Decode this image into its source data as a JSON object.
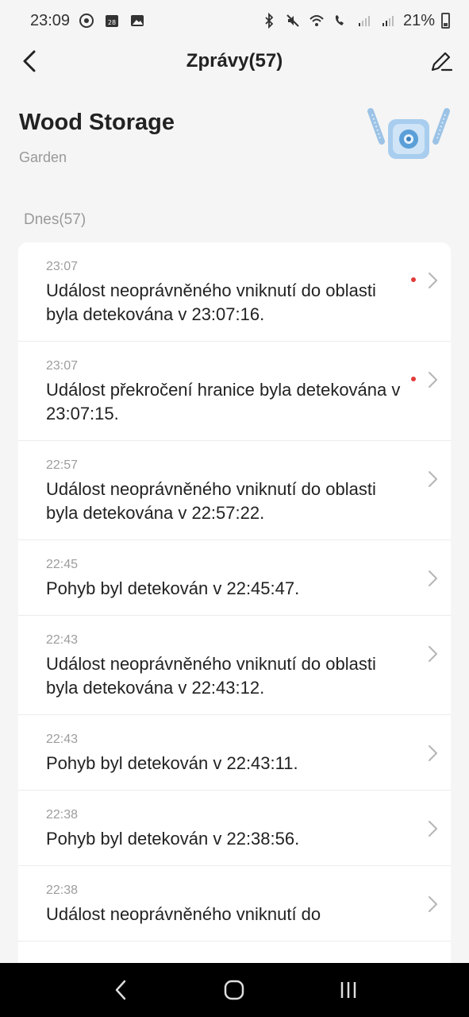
{
  "status_bar": {
    "time": "23:09",
    "calendar_day": "28",
    "battery": "21%"
  },
  "header": {
    "title": "Zprávy(57)",
    "back_icon": "back-arrow-icon",
    "edit_icon": "pencil-icon"
  },
  "device": {
    "name": "Wood Storage",
    "room": "Garden",
    "image_icon": "camera-device-icon"
  },
  "section": {
    "label": "Dnes(57)"
  },
  "messages": [
    {
      "time": "23:07",
      "text": "Událost neoprávněného vniknutí do oblasti byla detekována v 23:07:16.",
      "unread": true
    },
    {
      "time": "23:07",
      "text": "Událost překročení hranice byla detekována v 23:07:15.",
      "unread": true
    },
    {
      "time": "22:57",
      "text": "Událost neoprávněného vniknutí do oblasti byla detekována v 22:57:22.",
      "unread": false
    },
    {
      "time": "22:45",
      "text": "Pohyb byl detekován v 22:45:47.",
      "unread": false
    },
    {
      "time": "22:43",
      "text": "Událost neoprávněného vniknutí do oblasti byla detekována v 22:43:12.",
      "unread": false
    },
    {
      "time": "22:43",
      "text": "Pohyb byl detekován v 22:43:11.",
      "unread": false
    },
    {
      "time": "22:38",
      "text": "Pohyb byl detekován v 22:38:56.",
      "unread": false
    },
    {
      "time": "22:38",
      "text": "Událost neoprávněného vniknutí do",
      "unread": false
    }
  ],
  "colors": {
    "unread_dot": "#e23b3b",
    "background": "#f5f5f5"
  }
}
